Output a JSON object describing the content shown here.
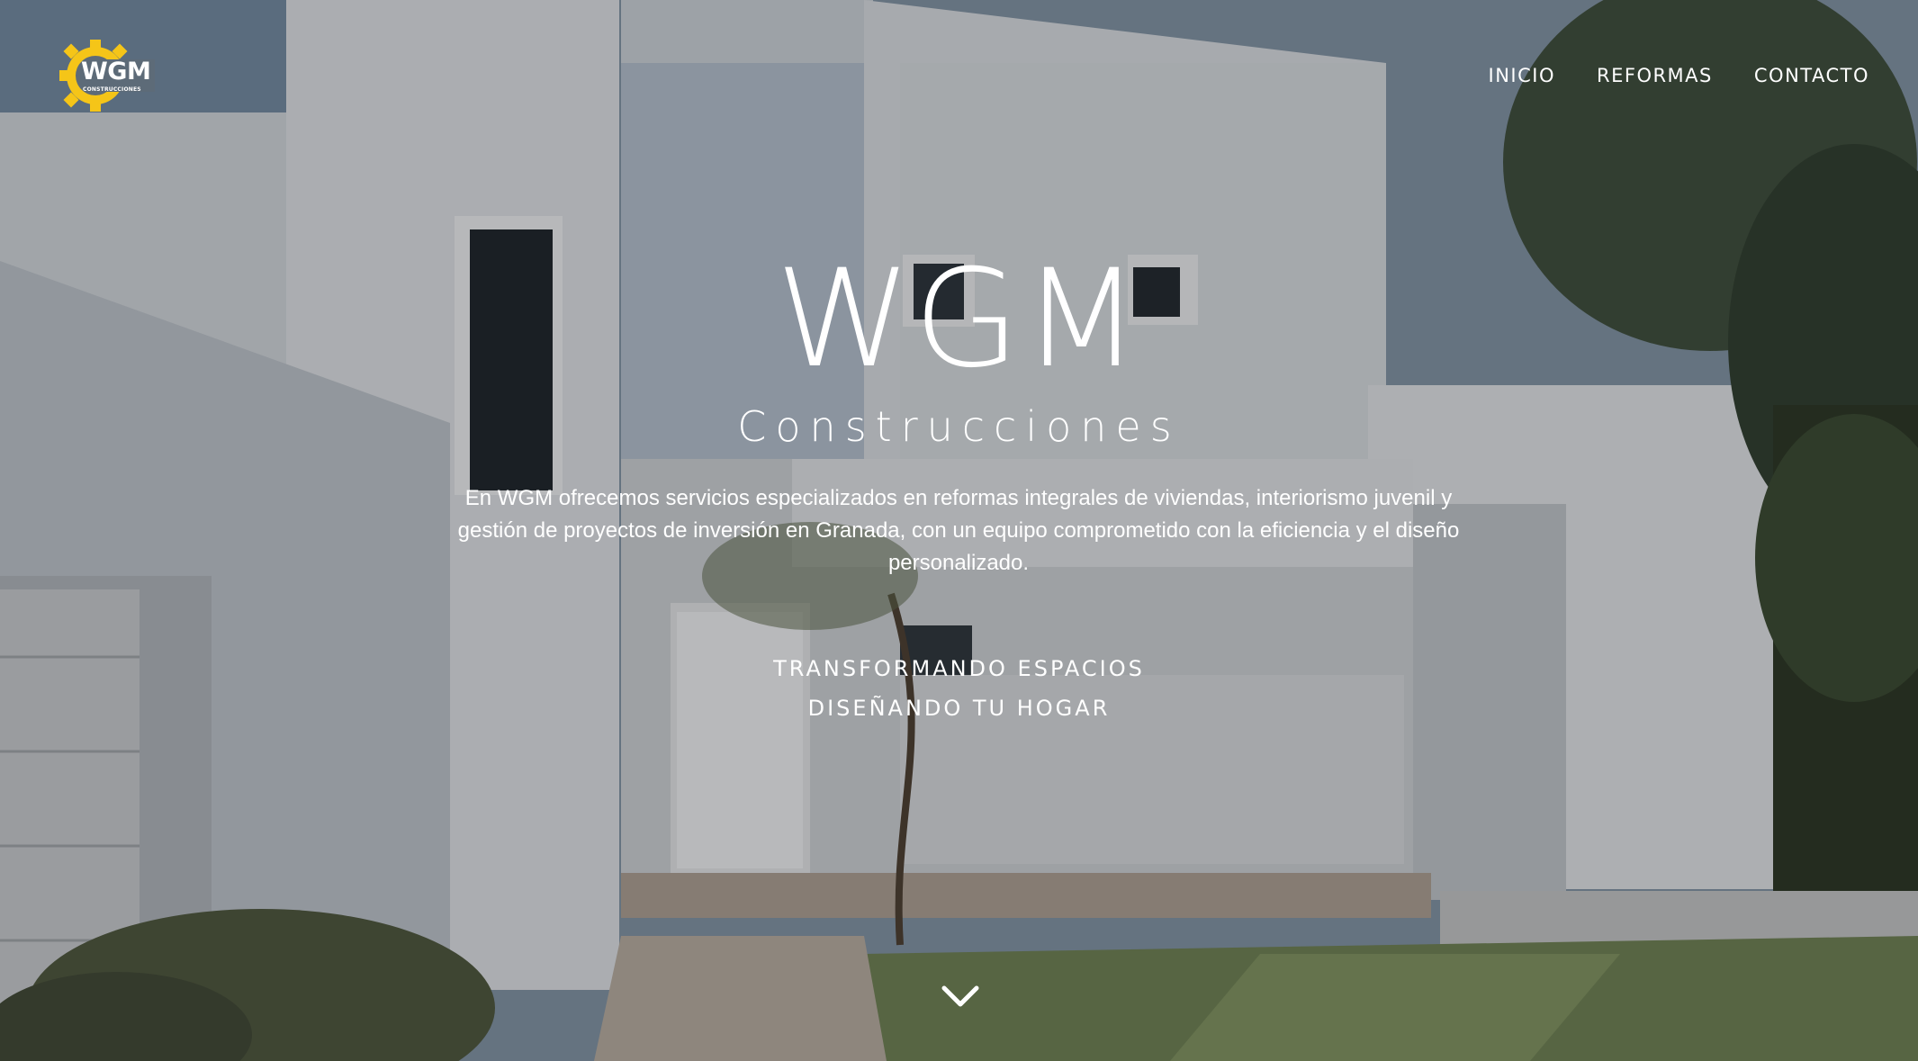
{
  "brand": {
    "logo_text": "WGM",
    "logo_subtext": "CONSTRUCCIONES",
    "accent_color": "#f5c518"
  },
  "nav": {
    "items": [
      {
        "label": "INICIO"
      },
      {
        "label": "REFORMAS"
      },
      {
        "label": "CONTACTO"
      }
    ]
  },
  "hero": {
    "title": "WGM",
    "subtitle": "Construcciones",
    "description": "En WGM ofrecemos servicios especializados en reformas integrales de viviendas, interiorismo juvenil y gestión de proyectos de inversión en Granada, con un equipo comprometido con la eficiencia y el diseño personalizado.",
    "tagline_line1": "TRANSFORMANDO ESPACIOS",
    "tagline_line2": "DISEÑANDO TU HOGAR",
    "scroll_icon": "chevron-down-icon"
  }
}
